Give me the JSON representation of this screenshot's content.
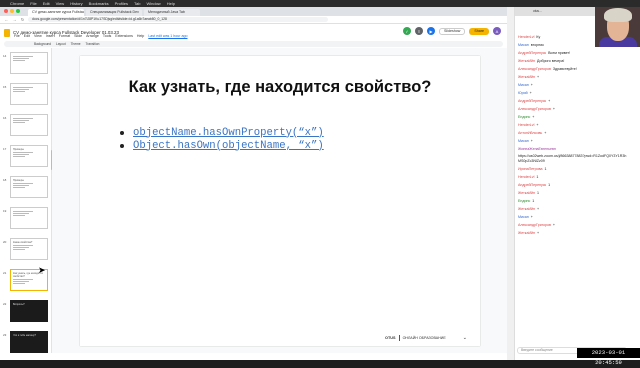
{
  "os_menu": [
    "Chrome",
    "File",
    "Edit",
    "View",
    "History",
    "Bookmarks",
    "Profiles",
    "Tab",
    "Window",
    "Help"
  ],
  "browser": {
    "tabs": [
      {
        "title": "CV демо-занятие курса Fullstack",
        "active": true
      },
      {
        "title": "Специализация Fullstack Dev",
        "active": false
      },
      {
        "title": "Мелодичный Java Tab",
        "active": false
      }
    ],
    "url": "docs.google.com/presentation/d/1n7lJ8P1Ku17SDjsg/edit#slide=id.g1a6b7aeab80_0_128"
  },
  "doc": {
    "title": "CV демо-занятие курса Fullstack Developer 01.03.23",
    "menu": [
      "File",
      "Edit",
      "View",
      "Insert",
      "Format",
      "Slide",
      "Arrange",
      "Tools",
      "Extensions",
      "Help"
    ],
    "last_edit": "Last edit was 1 hour ago",
    "slideshow_label": "Slideshow",
    "share_label": "Share",
    "toolbar": [
      "Background",
      "Layout",
      "Theme",
      "Transition"
    ]
  },
  "filmstrip": {
    "slides": [
      {
        "num": "14",
        "caption": "",
        "dark": false,
        "selected": false
      },
      {
        "num": "15",
        "caption": "",
        "dark": false,
        "selected": false
      },
      {
        "num": "16",
        "caption": "",
        "dark": false,
        "selected": false
      },
      {
        "num": "17",
        "caption": "Примеры",
        "dark": false,
        "selected": false
      },
      {
        "num": "18",
        "caption": "Примеры",
        "dark": false,
        "selected": false
      },
      {
        "num": "19",
        "caption": "",
        "dark": false,
        "selected": false
      },
      {
        "num": "20",
        "caption": "Какие свойства?",
        "dark": false,
        "selected": false
      },
      {
        "num": "21",
        "caption": "Как узнать, где находится свойство?",
        "dark": false,
        "selected": true
      },
      {
        "num": "22",
        "caption": "Вопросы?",
        "dark": true,
        "selected": false
      },
      {
        "num": "23",
        "caption": "Что я тебе напишу?",
        "dark": true,
        "selected": false
      }
    ]
  },
  "slide": {
    "title": "Как узнать, где находится свойство?",
    "bullets": [
      "objectName.hasOwnProperty(“x”)",
      "Object.hasOwn(objectName, “x”)"
    ],
    "footer_brand": "OTUS",
    "footer_text": "ОНЛАЙН ОБРАЗОВАНИЕ"
  },
  "chat": {
    "tab_title": "otus...",
    "messages": [
      {
        "author": "HenderLvl",
        "text": "Ку",
        "color": "r"
      },
      {
        "author": "Мисан",
        "text": "вторник",
        "color": "b"
      },
      {
        "author": "АндрейПерепуск",
        "text": "Всем привет!",
        "color": "r"
      },
      {
        "author": "ЖеткаИйн",
        "text": "Доброго вечера!",
        "color": "r"
      },
      {
        "author": "АлександрГригоров",
        "text": "Здравствуйте!",
        "color": "r"
      },
      {
        "author": "ЖеткаИйн",
        "text": "+",
        "color": "r"
      },
      {
        "author": "Мисан",
        "text": "+",
        "color": "b"
      },
      {
        "author": "Юрий",
        "text": "+",
        "color": "b"
      },
      {
        "author": "АндрейПерепуск",
        "text": "+",
        "color": "r"
      },
      {
        "author": "АлександрГригоров",
        "text": "+",
        "color": "r"
      },
      {
        "author": "Ендинс",
        "text": "+",
        "color": "g"
      },
      {
        "author": "HenderLvl",
        "text": "+",
        "color": "r"
      },
      {
        "author": "АнтонИйлсовь",
        "text": "+",
        "color": "r"
      },
      {
        "author": "Мисан",
        "text": "+",
        "color": "b"
      },
      {
        "author": "ЖиннаЖенаЕвгеньевн",
        "text": "https://us02web.zoom.us/j/86638877883?pwd=R1ZodFQ0Y3Y1R3hMS0pZc3NlZz09",
        "color": "p"
      },
      {
        "author": "ИринаПетрова",
        "text": "1",
        "color": "r"
      },
      {
        "author": "HenderLvl",
        "text": "1",
        "color": "r"
      },
      {
        "author": "АндрейПерепуск",
        "text": "1",
        "color": "r"
      },
      {
        "author": "ЖеткаИйн",
        "text": "1",
        "color": "r"
      },
      {
        "author": "Ендинс",
        "text": "1",
        "color": "g"
      },
      {
        "author": "ЖеткаИйн",
        "text": "+",
        "color": "r"
      },
      {
        "author": "Мисан",
        "text": "+",
        "color": "b"
      },
      {
        "author": "АлександрГригоров",
        "text": "+",
        "color": "r"
      },
      {
        "author": "ЖеткаИйн",
        "text": "+",
        "color": "r"
      }
    ],
    "input_placeholder": "Введите сообщение"
  },
  "timestamp": "2023-03-01 20:45:59"
}
